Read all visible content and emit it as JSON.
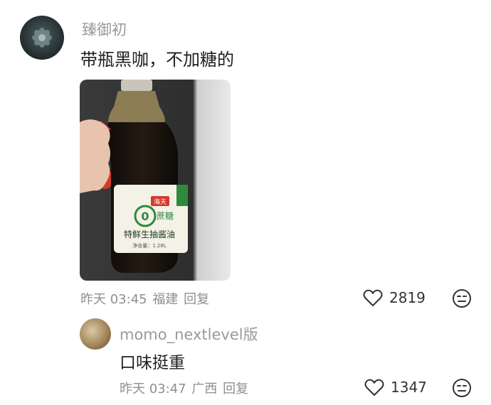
{
  "comments": [
    {
      "username": "臻御初",
      "text": "带瓶黑咖，不加糖的",
      "time": "昨天 03:45",
      "location": "福建",
      "reply_label": "回复",
      "likes": "2819",
      "photo": {
        "brand_badge": "海天",
        "zero_label": "0",
        "sugar_label": "蔗糖",
        "product_name": "特鲜生抽酱油",
        "volume": "净含量：1.28L"
      }
    },
    {
      "username": "momo_nextlevel版",
      "text": "口味挺重",
      "time": "昨天 03:47",
      "location": "广西",
      "reply_label": "回复",
      "likes": "1347"
    }
  ],
  "icons": {
    "like": "heart-outline-icon",
    "dislike": "neutral-face-icon"
  }
}
